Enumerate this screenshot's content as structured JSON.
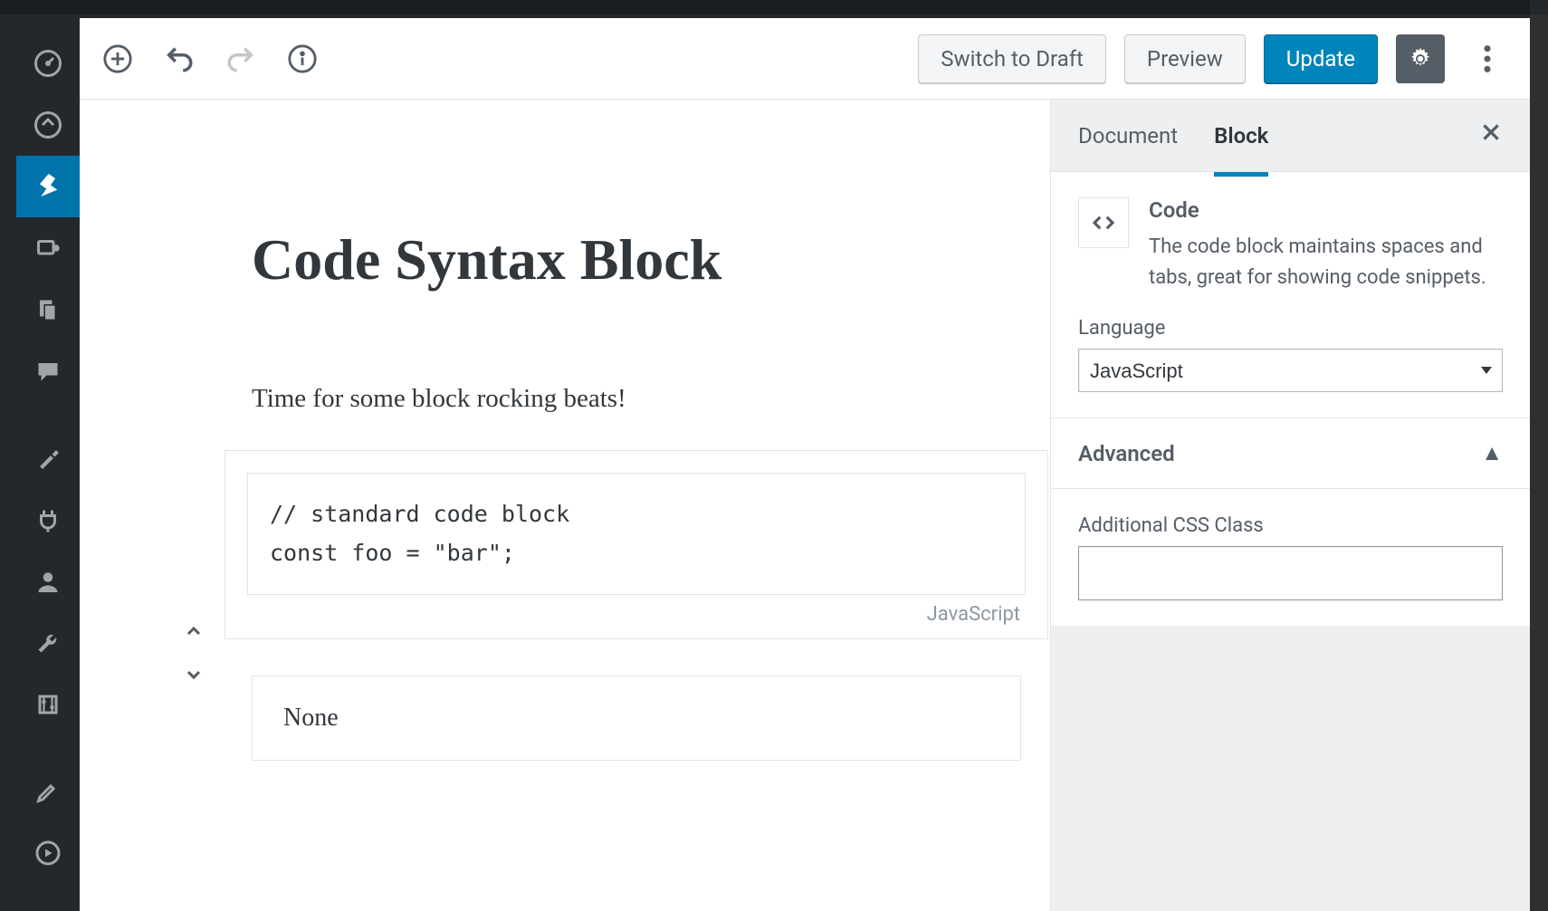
{
  "header": {
    "switch_draft": "Switch to Draft",
    "preview": "Preview",
    "update": "Update"
  },
  "post": {
    "title": "Code Syntax Block",
    "paragraph": "Time for some block rocking beats!",
    "code_content": "// standard code block\nconst foo = \"bar\";",
    "code_lang_label": "JavaScript",
    "none_block": "None"
  },
  "sidebar_panel": {
    "tabs": {
      "document": "Document",
      "block": "Block"
    },
    "code": {
      "title": "Code",
      "description": "The code block maintains spaces and tabs, great for showing code snippets."
    },
    "language_label": "Language",
    "language_value": "JavaScript",
    "advanced_label": "Advanced",
    "css_class_label": "Additional CSS Class",
    "css_class_value": ""
  }
}
